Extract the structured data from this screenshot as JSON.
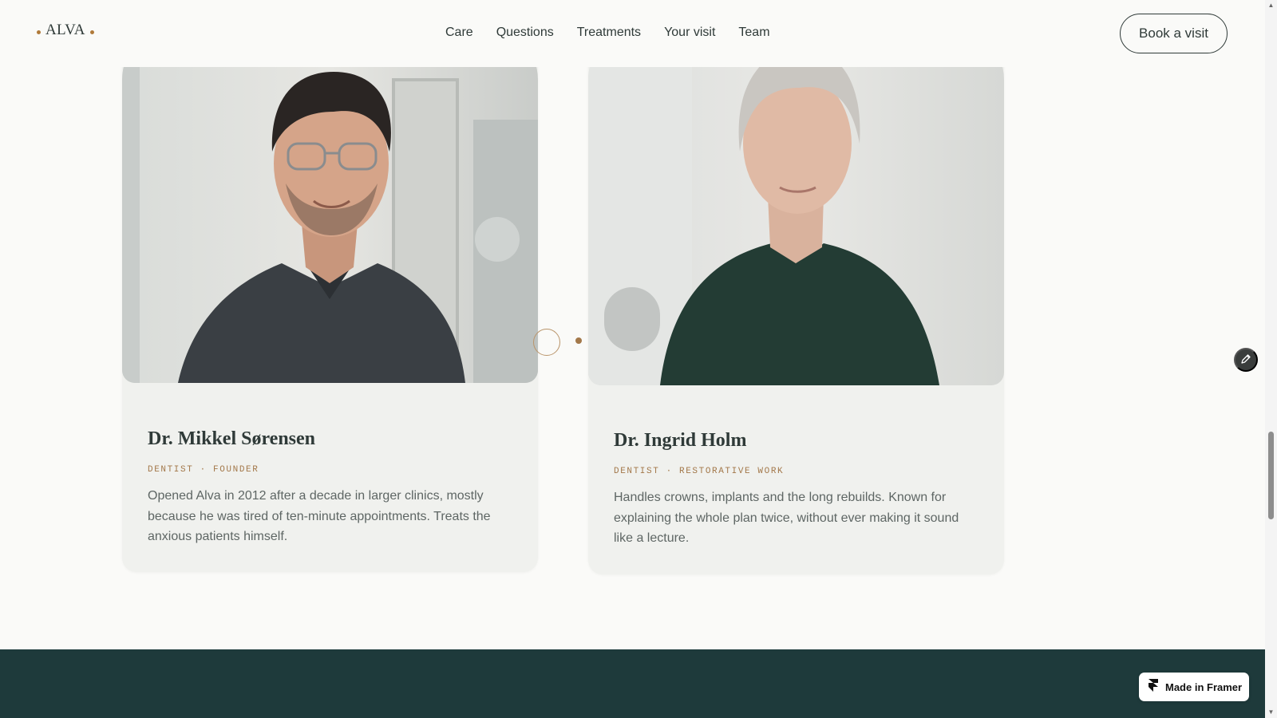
{
  "header": {
    "logo": "ALVA",
    "nav": [
      "Care",
      "Questions",
      "Treatments",
      "Your visit",
      "Team"
    ],
    "cta": "Book a visit"
  },
  "team": [
    {
      "name": "Dr. Mikkel Sørensen",
      "role": "DENTIST · FOUNDER",
      "bio": "Opened Alva in 2012 after a decade in larger clinics, mostly because he was tired of ten-minute appointments. Treats the anxious patients himself."
    },
    {
      "name": "Dr. Ingrid Holm",
      "role": "DENTIST · RESTORATIVE WORK",
      "bio": "Handles crowns, implants and the long rebuilds. Known for explaining the whole plan twice, without ever making it sound like a lecture."
    }
  ],
  "badge": {
    "label": "Made in Framer"
  },
  "colors": {
    "accent": "#a3784a",
    "ink": "#2f3a38",
    "footer": "#1e3a3b",
    "card": "#f0f1ee"
  },
  "icons": {
    "edit": "pencil-icon",
    "framer": "framer-logo-icon"
  }
}
